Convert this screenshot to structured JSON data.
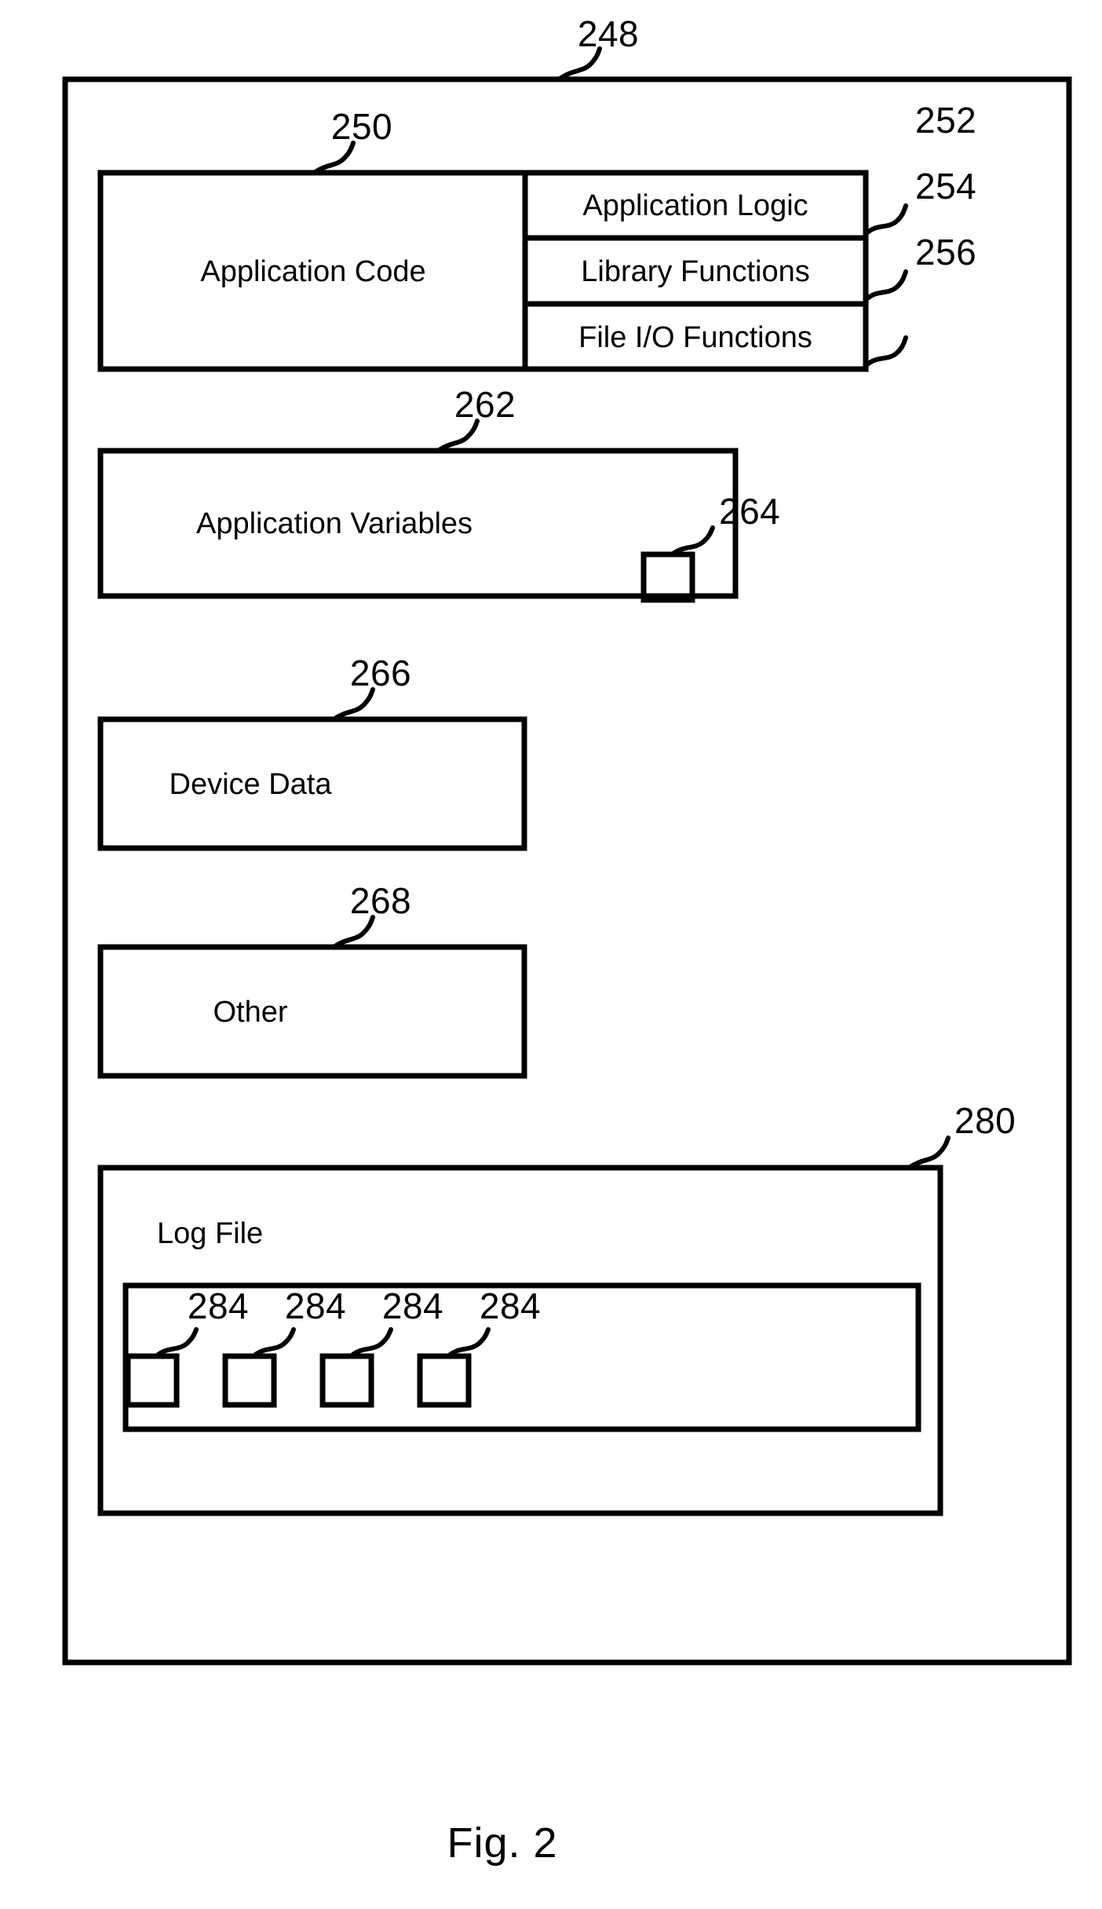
{
  "figure": {
    "caption": "Fig. 2",
    "outer_ref": "248"
  },
  "blocks": {
    "application_code": {
      "label": "Application Code",
      "ref": "250"
    },
    "application_logic": {
      "label": "Application Logic",
      "ref": "252"
    },
    "library_functions": {
      "label": "Library Functions",
      "ref": "254"
    },
    "file_io_functions": {
      "label": "File I/O Functions",
      "ref": "256"
    },
    "application_variables": {
      "label": "Application Variables",
      "ref": "262",
      "inner_square_ref": "264"
    },
    "device_data": {
      "label": "Device Data",
      "ref": "266"
    },
    "other": {
      "label": "Other",
      "ref": "268"
    },
    "log_file": {
      "label": "Log File",
      "ref": "280",
      "entry_refs": [
        "284",
        "284",
        "284",
        "284"
      ]
    }
  },
  "colors": {
    "line": "#000000",
    "background": "#ffffff",
    "text": "#000000"
  }
}
